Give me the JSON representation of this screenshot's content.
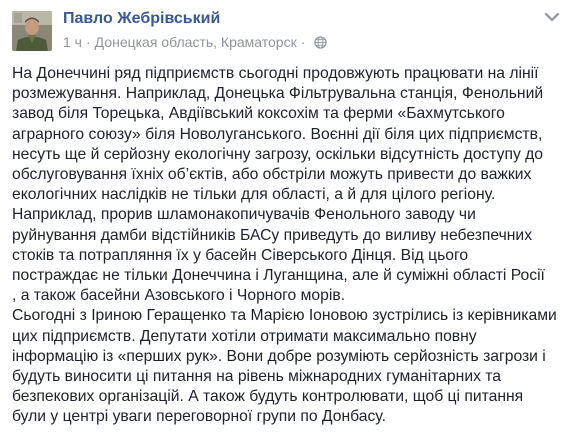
{
  "post": {
    "author": "Павло Жебрівський",
    "time": "1 ч",
    "separator": "·",
    "location": "Донецкая область, Краматорск",
    "paragraphs": [
      [
        "На Донеччині ряд підприємств сьогодні продовжують працювати на лінії",
        "розмежування. Наприклад, Донецька Фільтрувальна станція, Фенольний",
        "завод біля Торецька, Авдіївський коксохім та ферми «Бахмутського",
        "аграрного союзу» біля Новолуганського. Воєнні дії біля цих підприємств,",
        "несуть ще й серйозну екологічну загрозу, оскільки відсутність доступу до",
        "обслуговування їхніх об’єктів, або обстріли можуть привести до важких",
        "екологічних наслідків не тільки для області, а й для цілого регіону."
      ],
      [
        "Наприклад, прорив шламонакопичувачів Фенольного заводу чи",
        "руйнування дамби відстійників БАСу приведуть до виливу небезпечних",
        "стоків та потрапляння їх у басейн Сіверського Дінця. Від цього",
        "постраждає не тільки Донеччина і Луганщина, але й суміжні області Росії",
        ", а також басейни Азовського і Чорного морів."
      ],
      [
        "Сьогодні з Іриною Геращенко та Марією Іоновою зустрілись із керівниками",
        "цих підприємств. Депутати хотіли отримати максимально повну",
        "інформацію із «перших рук». Вони добре розуміють серйозність загрози і",
        "будуть виносити ці питання на рівень міжнародних гуманітарних та",
        "безпекових організацій. А також будуть контролювати, щоб ці питання",
        "були у центрі уваги переговорної групи по Донбасу."
      ]
    ]
  },
  "icons": {
    "globe": "globe-icon",
    "menu": "chevron-down-icon",
    "avatar": "avatar"
  },
  "colors": {
    "author_link": "#365899",
    "meta_gray": "#90949c",
    "text": "#1d2129"
  }
}
